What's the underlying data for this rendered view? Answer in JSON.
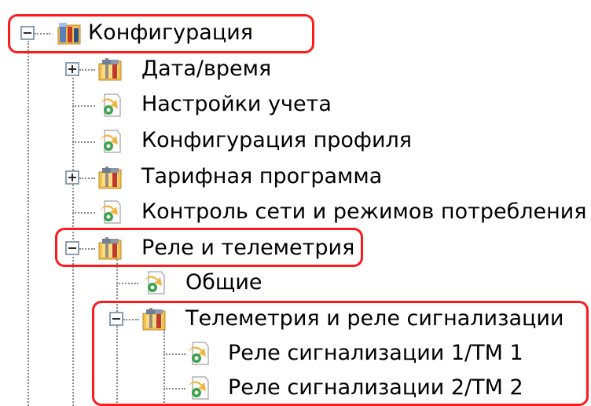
{
  "tree": {
    "root": {
      "label": "Конфигурация",
      "icon": "config-folder-icon",
      "expanded": true
    },
    "items": [
      {
        "label": "Дата/время",
        "icon": "tools-folder-icon",
        "expander": "plus"
      },
      {
        "label": "Настройки учета",
        "icon": "settings-page-icon"
      },
      {
        "label": "Конфигурация профиля",
        "icon": "settings-page-icon"
      },
      {
        "label": "Тарифная программа",
        "icon": "tools-folder-icon",
        "expander": "plus"
      },
      {
        "label": "Контроль сети и режимов потребления",
        "icon": "settings-page-icon"
      },
      {
        "label": "Реле и телеметрия",
        "icon": "tools-folder-icon",
        "expander": "minus"
      }
    ],
    "relay_children": [
      {
        "label": "Общие",
        "icon": "settings-page-icon"
      },
      {
        "label": "Телеметрия и реле сигнализации",
        "icon": "tools-folder-icon",
        "expander": "minus"
      }
    ],
    "telemetry_children": [
      {
        "label": "Реле сигнализации 1/ТМ 1",
        "icon": "settings-page-icon"
      },
      {
        "label": "Реле сигнализации 2/ТМ 2",
        "icon": "settings-page-icon"
      }
    ]
  },
  "colors": {
    "highlight": "#ff1a1a",
    "tree_lines": "#8a8a8a"
  }
}
